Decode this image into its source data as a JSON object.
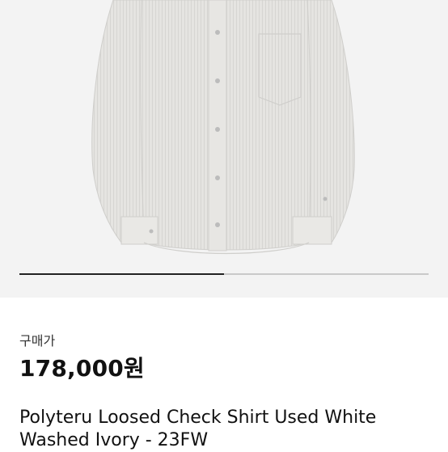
{
  "product": {
    "image_alt": "Shirt photo",
    "carousel_progress": 0.5,
    "price_label": "구매가",
    "price": "178,000원",
    "title": "Polyteru Loosed Check Shirt Used White Washed Ivory - 23FW"
  },
  "colors": {
    "photo_background": "#f3f3f3",
    "shirt": "#e4e3e0",
    "indicator_active": "#222222",
    "indicator_track": "#c9c9c9"
  }
}
